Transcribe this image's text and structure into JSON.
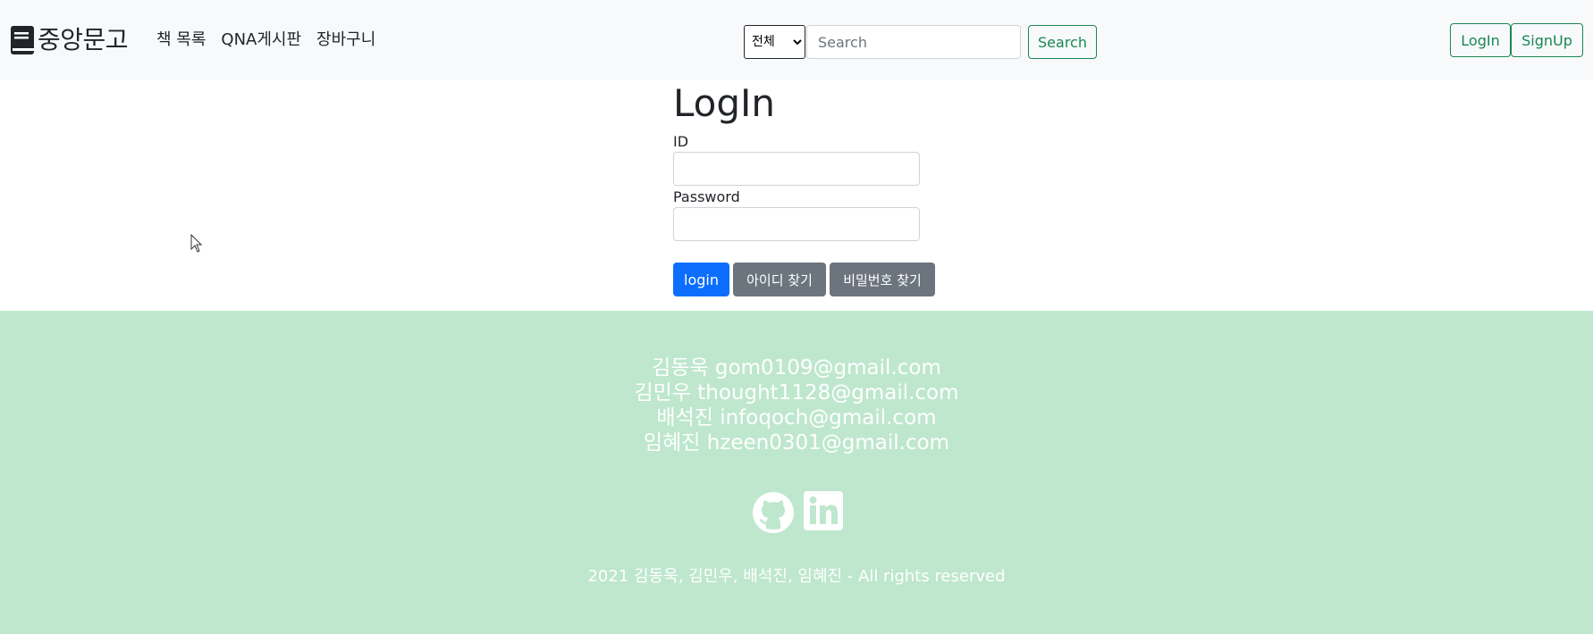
{
  "navbar": {
    "brand_text": "중앙문고",
    "brand_icon": "book-icon",
    "links": [
      "책 목록",
      "QNA게시판",
      "장바구니"
    ],
    "search": {
      "category_selected": "전체",
      "placeholder": "Search",
      "value": "",
      "button_label": "Search"
    },
    "auth": {
      "login_label": "LogIn",
      "signup_label": "SignUp"
    },
    "accent_color": "#198754"
  },
  "login": {
    "title": "LogIn",
    "id_label": "ID",
    "id_value": "",
    "password_label": "Password",
    "password_value": "",
    "login_button": "login",
    "find_id_button": "아이디 찾기",
    "find_password_button": "비밀번호 찾기",
    "primary_color": "#0d6efd",
    "secondary_color": "#6c757d"
  },
  "footer": {
    "background_color": "#bee7cd",
    "contacts": [
      "김동욱 gom0109@gmail.com",
      "김민우 thought1128@gmail.com",
      "배석진 infoqoch@gmail.com",
      "임혜진 hzeen0301@gmail.com"
    ],
    "social_icons": [
      "github-icon",
      "linkedin-icon"
    ],
    "copyright": "2021 김동욱, 김민우, 배석진, 임혜진 - All rights reserved"
  }
}
